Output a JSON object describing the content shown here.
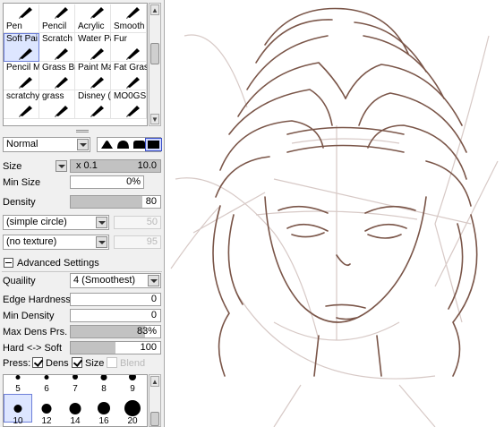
{
  "tools": {
    "items": [
      {
        "label": "Pen",
        "icon": "pen-icon",
        "selected": false
      },
      {
        "label": "Pencil",
        "icon": "pencil-icon",
        "selected": false
      },
      {
        "label": "Acrylic",
        "icon": "acrylic-brush-icon",
        "selected": false
      },
      {
        "label": "Smooth",
        "icon": "smudge-icon",
        "selected": false
      },
      {
        "label": "Soft Pai",
        "icon": "soft-paint-icon",
        "selected": true
      },
      {
        "label": "Scratch I",
        "icon": "scratch-brush-icon",
        "selected": false
      },
      {
        "label": "Water Pa",
        "icon": "water-paint-icon",
        "selected": false
      },
      {
        "label": "Fur",
        "icon": "fur-brush-icon",
        "selected": false
      },
      {
        "label": "Pencil M",
        "icon": "pencil-mix-icon",
        "selected": false
      },
      {
        "label": "Grass Br",
        "icon": "grass-brush-icon",
        "selected": false
      },
      {
        "label": "Paint Ma",
        "icon": "paint-marker-icon",
        "selected": false
      },
      {
        "label": "Fat Gras",
        "icon": "fat-grass-icon",
        "selected": false
      },
      {
        "label": "scratchy",
        "icon": "scratchy-brush-icon",
        "selected": false
      },
      {
        "label": "grass",
        "icon": "grass-icon",
        "selected": false
      },
      {
        "label": "Disney (",
        "icon": "disney-brush-icon",
        "selected": false
      },
      {
        "label": "MO0GS",
        "icon": "custom-brush-icon",
        "selected": false
      }
    ]
  },
  "blend_mode": "Normal",
  "brush_shapes": [
    "flat-shape-icon",
    "round-shape-icon",
    "square-shape-icon",
    "filled-square-icon"
  ],
  "size": {
    "label": "Size",
    "multiplier": "x 0.1",
    "value": "10.0"
  },
  "min_size": {
    "label": "Min Size",
    "value": "0%"
  },
  "density": {
    "label": "Density",
    "value": "80",
    "level": 80
  },
  "shape": {
    "value": "(simple circle)",
    "amount": "50"
  },
  "texture": {
    "value": "(no texture)",
    "amount": "95"
  },
  "advanced": {
    "title": "Advanced Settings",
    "quality_label": "Quaility",
    "quality_value": "4 (Smoothest)",
    "edge_hardness": {
      "label": "Edge Hardness",
      "value": "0",
      "level": 0
    },
    "min_density": {
      "label": "Min Density",
      "value": "0",
      "level": 0
    },
    "max_dens_prs": {
      "label": "Max Dens Prs.",
      "value": "83%",
      "level": 83
    },
    "hard_soft": {
      "label": "Hard <-> Soft",
      "value": "100",
      "level": 100
    },
    "press_label": "Press:",
    "press_dens": {
      "label": "Dens",
      "checked": true
    },
    "press_size": {
      "label": "Size",
      "checked": true
    },
    "press_blend": {
      "label": "Blend",
      "checked": false
    }
  },
  "sizes": {
    "items": [
      {
        "label": "5"
      },
      {
        "label": "6"
      },
      {
        "label": "7"
      },
      {
        "label": "8"
      },
      {
        "label": "9"
      },
      {
        "label": "10",
        "selected": true
      },
      {
        "label": "12"
      },
      {
        "label": "14"
      },
      {
        "label": "16"
      },
      {
        "label": "20"
      }
    ]
  },
  "colors": {
    "line_art": "#7a5548",
    "sketch": "#d7c9c6",
    "accent": "#6d7fd9"
  }
}
